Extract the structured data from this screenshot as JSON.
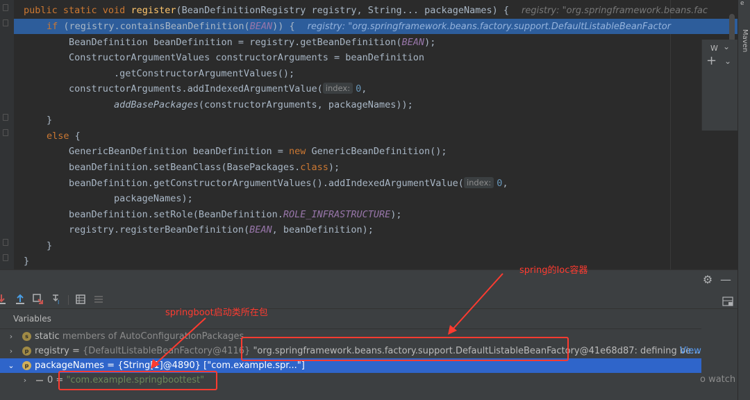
{
  "editor": {
    "lines": [
      {
        "id": "l1"
      },
      {
        "id": "l2"
      }
    ],
    "hint_line1": "registry: \"org.springframework.beans.fac",
    "hint_line2": "registry: \"org.springframework.beans.factory.support.DefaultListableBeanFactor",
    "param_hint_index": "index:"
  },
  "code": {
    "l1_a": "public static void ",
    "l1_fn": "register",
    "l1_b": "(BeanDefinitionRegistry registry, String... packageNames) {",
    "l2_kw": "if ",
    "l2_a": "(registry.containsBeanDefinition(",
    "l2_const": "BEAN",
    "l2_b": ")) {",
    "l3_a": "BeanDefinition beanDefinition = registry.getBeanDefinition(",
    "l3_const": "BEAN",
    "l3_b": ");",
    "l4": "ConstructorArgumentValues constructorArguments = beanDefinition",
    "l5": ".getConstructorArgumentValues();",
    "l6_a": "constructorArguments.addIndexedArgumentValue(",
    "l6_num": "0",
    "l6_b": ",",
    "l7_it": "addBasePackages",
    "l7_b": "(constructorArguments, packageNames));",
    "l8": "}",
    "l9_kw": "else ",
    "l9_b": "{",
    "l10_a": "GenericBeanDefinition beanDefinition = ",
    "l10_kw": "new ",
    "l10_b": "GenericBeanDefinition();",
    "l11_a": "beanDefinition.setBeanClass(BasePackages.",
    "l11_kw": "class",
    "l11_b": ");",
    "l12_a": "beanDefinition.getConstructorArgumentValues().addIndexedArgumentValue(",
    "l12_num": "0",
    "l12_b": ",",
    "l13": "packageNames);",
    "l14_a": "beanDefinition.setRole(BeanDefinition.",
    "l14_const": "ROLE_INFRASTRUCTURE",
    "l14_b": ");",
    "l15_a": "registry.registerBeanDefinition(",
    "l15_const": "BEAN",
    "l15_b": ", beanDefinition);",
    "l16": "}",
    "l17": "}"
  },
  "right_strip": {
    "maven_label": "Maven",
    "top_glyph": "e"
  },
  "debug": {
    "settings_icon": "⚙",
    "minimize_icon": "—",
    "variables_title": "Variables",
    "watch_tab": "W",
    "watch_hint": "o watch",
    "rows": {
      "static_label": "static",
      "static_rest": " members of AutoConfigurationPackages",
      "registry_name": "registry",
      "registry_eq": " = ",
      "registry_type": "{DefaultListableBeanFactory@4116} ",
      "registry_value": "\"org.springframework.beans.factory.support.DefaultListableBeanFactory@41e68d87: defining be...",
      "registry_view": "View",
      "packages_name": "packageNames",
      "packages_eq": " = ",
      "packages_type": "{String[1]@4890} ",
      "packages_value": "[\"com.example.spr...\"]",
      "item_index": "0",
      "item_eq": " = ",
      "item_value": "\"com.example.springboottest\""
    },
    "badge_static": "s",
    "badge_p": "p"
  },
  "annotations": {
    "ioc_label": "spring的Ioc容器",
    "startup_label": "springboot启动类所在包"
  },
  "colors": {
    "annotation": "#ff3b30",
    "selection": "#2f65ca",
    "current_line": "#2d5d9b"
  }
}
